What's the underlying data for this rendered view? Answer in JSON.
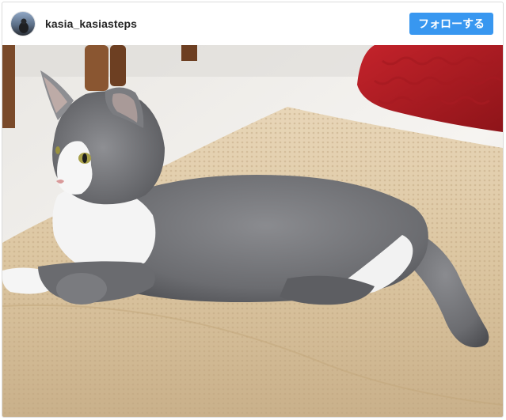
{
  "header": {
    "username": "kasia_kasiasteps",
    "avatar_icon": "profile-avatar-icon",
    "follow_label": "フォローする"
  },
  "photo": {
    "subject_icon": "cat-photo"
  },
  "colors": {
    "follow_button": "#3897f0",
    "username_text": "#262626",
    "border": "#dbdbdb"
  }
}
